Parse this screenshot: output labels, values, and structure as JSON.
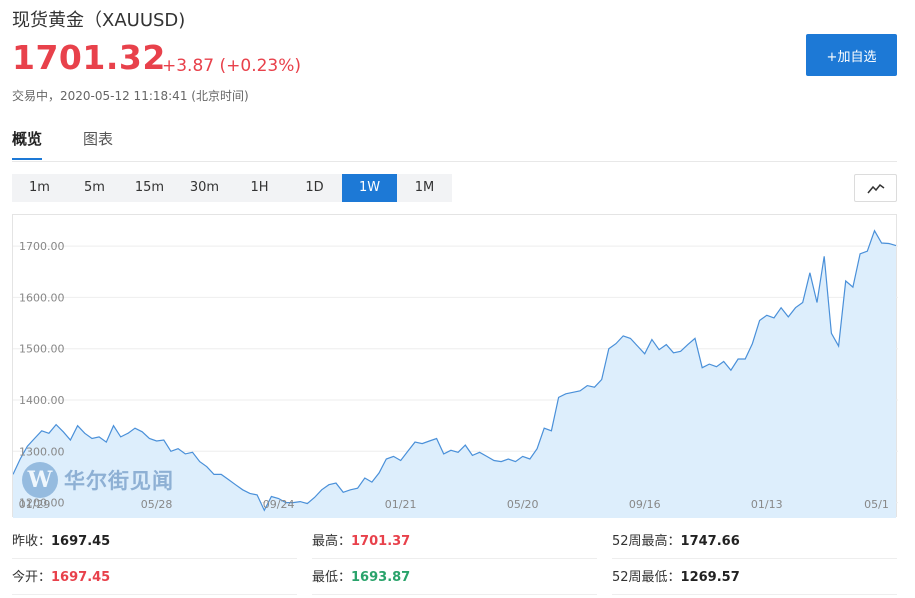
{
  "header": {
    "title": "现货黄金（XAUUSD)",
    "price": "1701.32",
    "change": "+3.87 (+0.23%)",
    "status": "交易中，2020-05-12 11:18:41 (北京时间)",
    "add_button": "+加自选"
  },
  "tabs": [
    {
      "label": "概览",
      "active": true
    },
    {
      "label": "图表",
      "active": false
    }
  ],
  "ranges": [
    "1m",
    "5m",
    "15m",
    "30m",
    "1H",
    "1D",
    "1W",
    "1M"
  ],
  "active_range": "1W",
  "chart_type_icon": "line-chart-icon",
  "watermark": {
    "text": "华尔街见闻"
  },
  "stats": [
    {
      "label": "昨收：",
      "value": "1697.45",
      "color": "dark"
    },
    {
      "label": "最高：",
      "value": "1701.37",
      "color": "red"
    },
    {
      "label": "52周最高：",
      "value": "1747.66",
      "color": "dark"
    },
    {
      "label": "今开：",
      "value": "1697.45",
      "color": "red"
    },
    {
      "label": "最低：",
      "value": "1693.87",
      "color": "green"
    },
    {
      "label": "52周最低：",
      "value": "1269.57",
      "color": "dark"
    }
  ],
  "chart_data": {
    "type": "area",
    "title": "",
    "xlabel": "",
    "ylabel": "",
    "ylim": [
      1170,
      1745
    ],
    "yticks": [
      1200,
      1300,
      1400,
      1500,
      1600,
      1700
    ],
    "ytick_labels": [
      "1200.00",
      "1300.00",
      "1400.00",
      "1500.00",
      "1600.00",
      "1700.00"
    ],
    "xtick_labels": [
      "01/29",
      "05/28",
      "09/24",
      "01/21",
      "05/20",
      "09/16",
      "01/13",
      "05/1"
    ],
    "xtick_index": [
      3,
      20,
      37,
      54,
      71,
      88,
      105,
      122
    ],
    "grid": true,
    "line_color": "#4a90d9",
    "fill_color": "#ddeefc",
    "values": [
      1255,
      1285,
      1310,
      1325,
      1340,
      1335,
      1352,
      1338,
      1322,
      1350,
      1335,
      1325,
      1328,
      1318,
      1350,
      1328,
      1335,
      1345,
      1338,
      1325,
      1320,
      1322,
      1300,
      1305,
      1295,
      1298,
      1280,
      1270,
      1255,
      1255,
      1245,
      1235,
      1225,
      1218,
      1215,
      1185,
      1212,
      1208,
      1200,
      1200,
      1202,
      1198,
      1210,
      1225,
      1235,
      1238,
      1220,
      1225,
      1228,
      1248,
      1240,
      1258,
      1285,
      1290,
      1282,
      1300,
      1318,
      1315,
      1320,
      1325,
      1295,
      1302,
      1298,
      1312,
      1292,
      1298,
      1290,
      1282,
      1280,
      1285,
      1280,
      1290,
      1285,
      1305,
      1345,
      1340,
      1405,
      1412,
      1415,
      1418,
      1428,
      1425,
      1440,
      1500,
      1510,
      1525,
      1520,
      1505,
      1490,
      1518,
      1498,
      1508,
      1492,
      1495,
      1508,
      1520,
      1463,
      1470,
      1465,
      1475,
      1458,
      1480,
      1480,
      1510,
      1555,
      1565,
      1560,
      1580,
      1562,
      1580,
      1590,
      1648,
      1590,
      1680,
      1530,
      1505,
      1632,
      1620,
      1685,
      1690,
      1730,
      1706,
      1705,
      1701
    ]
  }
}
